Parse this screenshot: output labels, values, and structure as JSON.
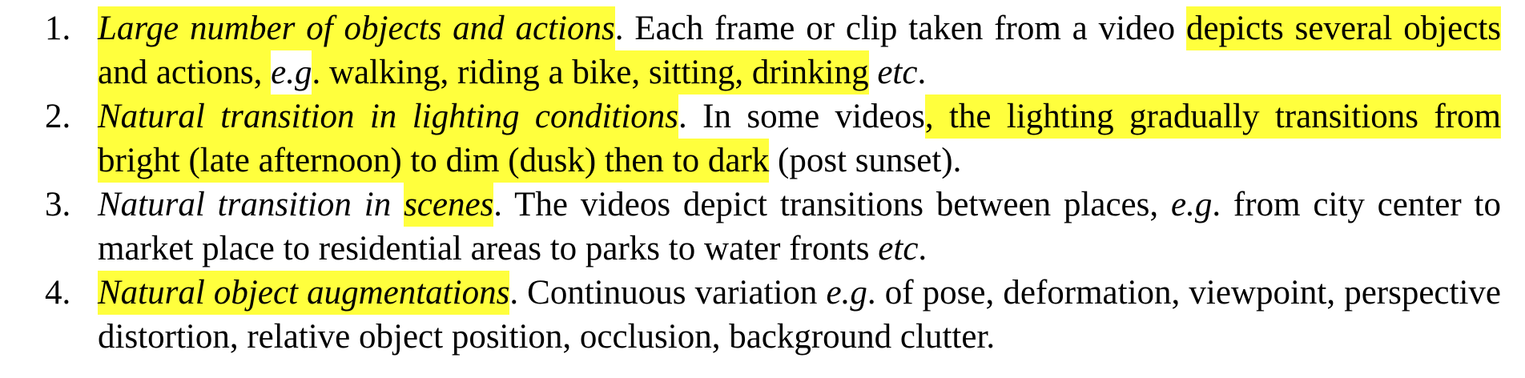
{
  "items": [
    {
      "number": "1.",
      "title": "Large number of objects and actions",
      "t1": ". Each frame or clip taken from a video ",
      "h1": "depicts several objects and actions, ",
      "eg": "e.g",
      "h2": ". walking, riding a bike, sitting, drinking",
      "t2": " ",
      "etc": "etc",
      "t3": "."
    },
    {
      "number": "2.",
      "title": "Natural transition in lighting conditions",
      "t1": ". In some videos",
      "h1": ", the lighting gradually transitions from bright (late afternoon) to dim (dusk) then to dark",
      "t2": " (post sunset)."
    },
    {
      "number": "3.",
      "title_a": "Natural transition in ",
      "title_b": "scenes",
      "t1": ".  The videos depict transitions between places, ",
      "eg": "e.g",
      "t2": ". from city center to market place to residential areas to parks to water fronts ",
      "etc": "etc",
      "t3": "."
    },
    {
      "number": "4.",
      "title": "Natural object augmentations",
      "t1": ". Continuous variation ",
      "eg": "e.g",
      "t2": ". of pose, deformation, viewpoint, perspective distortion, relative object position, occlusion, background clutter."
    }
  ],
  "colors": {
    "highlight": "#ffff3d",
    "text": "#000000"
  }
}
